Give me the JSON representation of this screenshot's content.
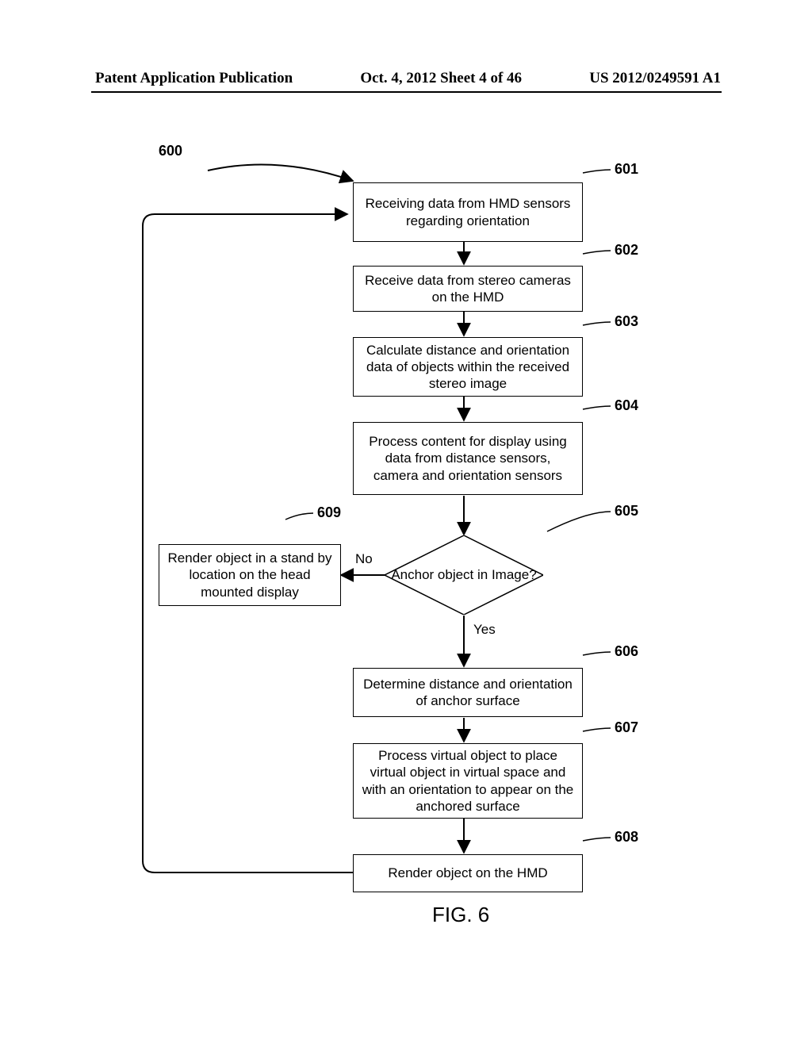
{
  "header": {
    "left": "Patent Application Publication",
    "center": "Oct. 4, 2012  Sheet 4 of 46",
    "right": "US 2012/0249591 A1"
  },
  "flow": {
    "ref600": "600",
    "ref601": "601",
    "ref602": "602",
    "ref603": "603",
    "ref604": "604",
    "ref605": "605",
    "ref606": "606",
    "ref607": "607",
    "ref608": "608",
    "ref609": "609",
    "box601": "Receiving data from HMD sensors regarding orientation",
    "box602": "Receive data from stereo cameras on the HMD",
    "box603": "Calculate distance and orientation data of objects within the received stereo image",
    "box604": "Process content for display using data from distance sensors, camera and orientation sensors",
    "decision605": "Anchor object in Image?",
    "box606": "Determine distance and orientation of anchor surface",
    "box607": "Process virtual object to place virtual object in virtual space and with an orientation to appear on the anchored surface",
    "box608": "Render object on the HMD",
    "box609": "Render object in a stand by location on the head mounted display",
    "no": "No",
    "yes": "Yes"
  },
  "caption": "FIG. 6"
}
